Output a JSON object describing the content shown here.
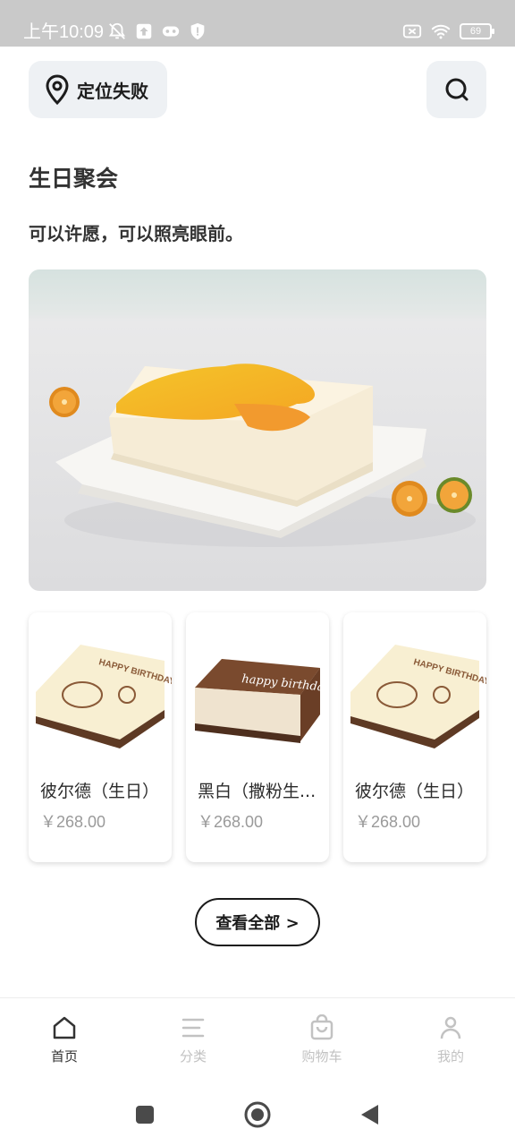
{
  "status_bar": {
    "time": "上午10:09",
    "battery": "69"
  },
  "header": {
    "location_label": "定位失败"
  },
  "section": {
    "title": "生日聚会",
    "subtitle": "可以许愿，可以照亮眼前。"
  },
  "products": [
    {
      "name": "彼尔德（生日）",
      "price": "￥268.00",
      "cake_text": "HAPPY BIRTHDAY!"
    },
    {
      "name": "黑白（撒粉生...",
      "price": "￥268.00",
      "cake_text": "happy birthday"
    },
    {
      "name": "彼尔德（生日）",
      "price": "￥268.00",
      "cake_text": "HAPPY BIRTHDAY!"
    }
  ],
  "view_all_label": "查看全部 >",
  "tabbar": [
    {
      "label": "首页",
      "icon": "home-icon",
      "active": true
    },
    {
      "label": "分类",
      "icon": "list-icon",
      "active": false
    },
    {
      "label": "购物车",
      "icon": "bag-icon",
      "active": false
    },
    {
      "label": "我的",
      "icon": "person-icon",
      "active": false
    }
  ],
  "colors": {
    "accent": "#333333",
    "inactive": "#c2c2c2",
    "chip_bg": "#eef1f4",
    "price": "#9a9a9a"
  }
}
